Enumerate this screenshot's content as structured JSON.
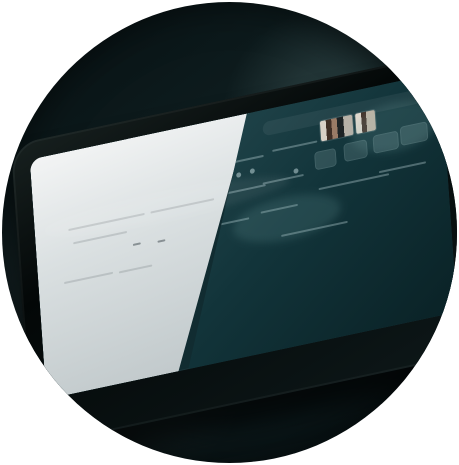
{
  "scene": {
    "subject": "tablet-photo"
  },
  "colors": {
    "background_dark": "#071012",
    "tablet_body": "#030707",
    "screen_teal": "#12343a",
    "paper_white": "#f4f6f6"
  }
}
